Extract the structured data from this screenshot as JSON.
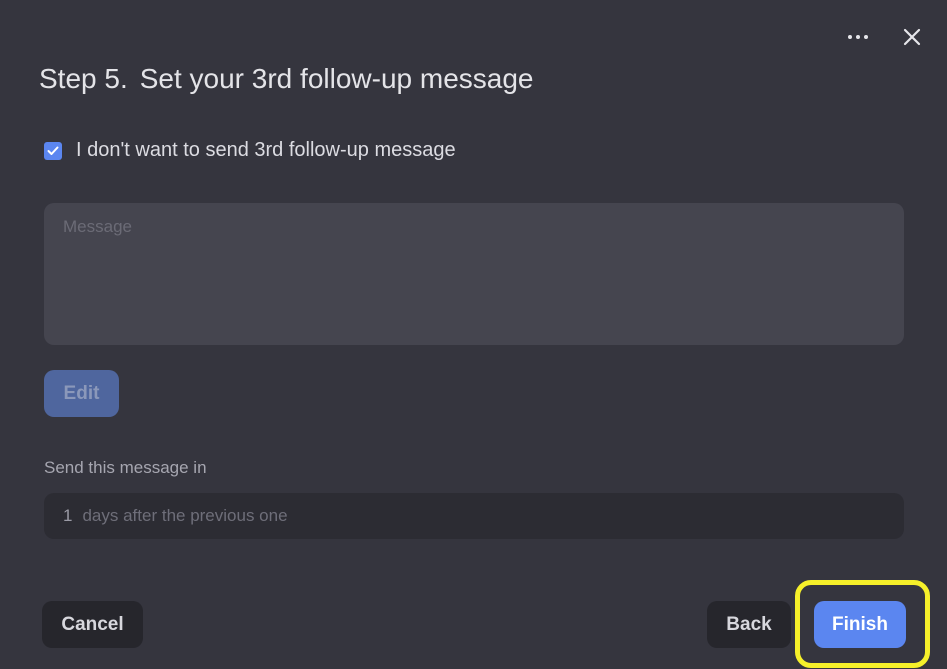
{
  "header": {
    "step": "Step 5.",
    "title": "Set your 3rd follow-up message",
    "more_icon": "more-horizontal-icon",
    "close_icon": "close-icon"
  },
  "skip_option": {
    "checked": true,
    "label": "I don't want to send 3rd follow-up message"
  },
  "message": {
    "placeholder": "Message",
    "value": ""
  },
  "edit_button": {
    "label": "Edit",
    "disabled": true
  },
  "schedule": {
    "label": "Send this message in",
    "days": "1",
    "suffix": "days after the previous one"
  },
  "footer": {
    "cancel_label": "Cancel",
    "back_label": "Back",
    "finish_label": "Finish"
  },
  "colors": {
    "background": "#35353e",
    "accent": "#5b86f0",
    "highlight": "#f6f02a"
  }
}
